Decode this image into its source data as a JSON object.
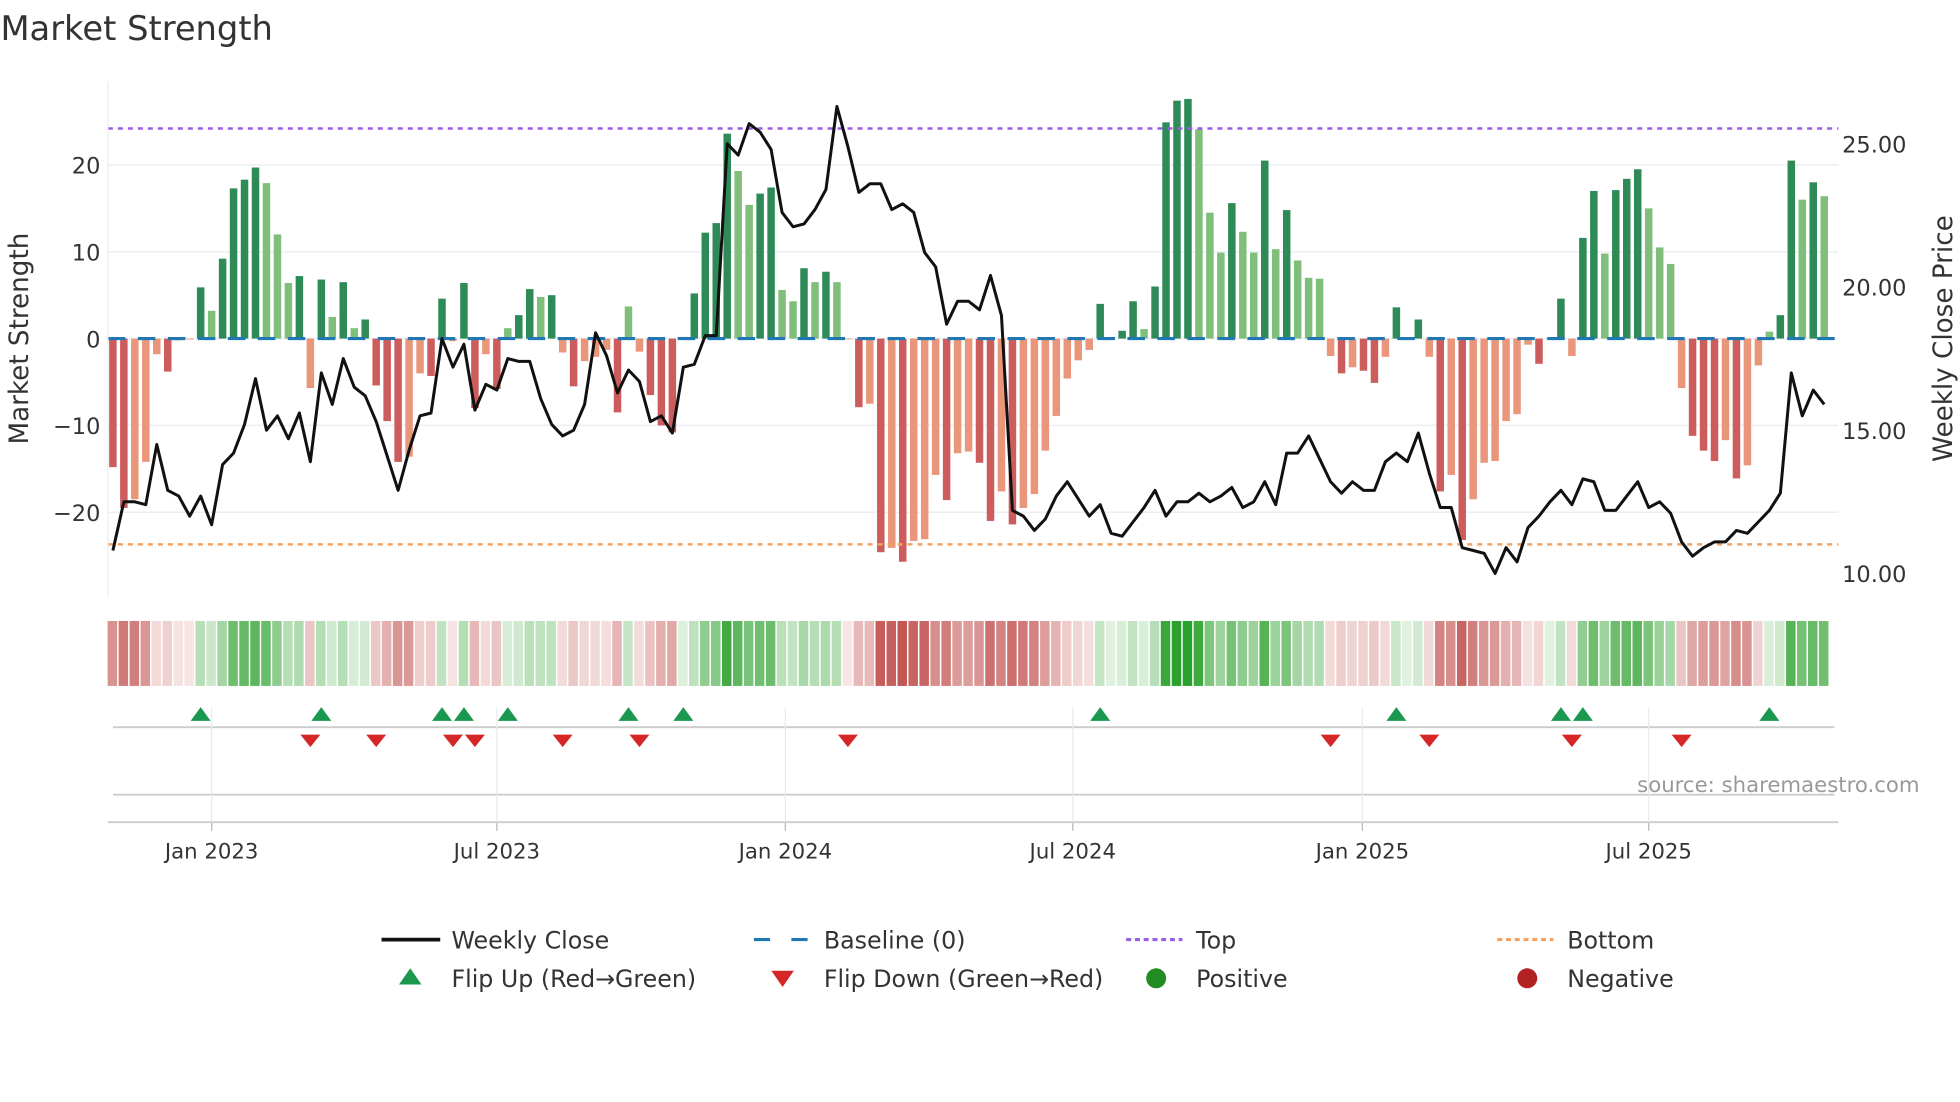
{
  "chart_data": {
    "type": "bar",
    "title": "Market Strength",
    "ylabel": "Market Strength",
    "y2label": "Weekly Close Price",
    "ylim": [
      -29.8,
      29.6
    ],
    "y2lim": [
      9.2,
      27.2
    ],
    "yticks": [
      {
        "v": 20,
        "label": "20"
      },
      {
        "v": 10,
        "label": "10"
      },
      {
        "v": 0,
        "label": "0"
      },
      {
        "v": -10,
        "label": "−10"
      },
      {
        "v": -20,
        "label": "−20"
      }
    ],
    "y2ticks": [
      {
        "v": 25,
        "label": "25.00"
      },
      {
        "v": 20,
        "label": "20.00"
      },
      {
        "v": 15,
        "label": "15.00"
      },
      {
        "v": 10,
        "label": "10.00"
      }
    ],
    "xticks": [
      {
        "week": 9,
        "label": "Jan 2023"
      },
      {
        "week": 35,
        "label": "Jul 2023"
      },
      {
        "week": 61.3,
        "label": "Jan 2024"
      },
      {
        "week": 87.5,
        "label": "Jul 2024"
      },
      {
        "week": 113.9,
        "label": "Jan 2025"
      },
      {
        "week": 140,
        "label": "Jul 2025"
      }
    ],
    "top_level": 24.2,
    "bottom_level": -23.7,
    "baseline": 0,
    "strength": [
      -14.8,
      -19.5,
      -18.5,
      -14.2,
      -1.8,
      -3.8,
      -0.2,
      -0.1,
      5.9,
      3.2,
      9.2,
      17.3,
      18.3,
      19.7,
      17.9,
      12,
      6.4,
      7.2,
      -5.7,
      6.8,
      2.5,
      6.5,
      1.2,
      2.2,
      -5.4,
      -9.5,
      -14.2,
      -13.6,
      -4,
      -4.3,
      4.6,
      -0.3,
      6.4,
      -8,
      -1.8,
      -5.8,
      1.2,
      2.7,
      5.7,
      4.8,
      5.0,
      -1.6,
      -5.5,
      -2.6,
      -2.1,
      -1.3,
      -8.5,
      3.7,
      -1.5,
      -6.5,
      -10,
      -10.8,
      0.2,
      5.2,
      12.2,
      13.3,
      23.6,
      19.3,
      15.4,
      16.7,
      17.4,
      5.6,
      4.3,
      8.1,
      6.5,
      7.7,
      6.5,
      -0.1,
      -7.9,
      -7.5,
      -24.6,
      -24.1,
      -25.7,
      -23.3,
      -23.1,
      -15.7,
      -18.6,
      -13.2,
      -13,
      -14.3,
      -21,
      -17.6,
      -21.4,
      -19.5,
      -17.9,
      -12.9,
      -8.9,
      -4.6,
      -2.5,
      -1.3,
      4.0,
      0,
      0.9,
      4.3,
      1.1,
      6,
      24.9,
      27.4,
      27.6,
      24.1,
      14.5,
      9.9,
      15.6,
      12.3,
      9.9,
      20.5,
      10.3,
      14.8,
      9,
      7.0,
      6.9,
      -2,
      -4,
      -3.3,
      -3.7,
      -5.1,
      -2.1,
      3.6,
      0,
      2.2,
      -2.1,
      -17.6,
      -15.7,
      -23.2,
      -18.5,
      -14.3,
      -14.1,
      -9.5,
      -8.7,
      -0.7,
      -2.9,
      0,
      4.6,
      -2,
      11.6,
      17,
      9.8,
      17.1,
      18.4,
      19.5,
      15,
      10.5,
      8.6,
      -5.7,
      -11.2,
      -12.9,
      -14.1,
      -11.7,
      -16.1,
      -14.6,
      -3.1,
      0.8,
      2.7,
      20.5,
      16,
      18,
      16.4
    ],
    "weekly_close": [
      10.8,
      12.5,
      12.5,
      12.4,
      14.5,
      12.9,
      12.7,
      12.0,
      12.7,
      11.7,
      13.8,
      14.2,
      15.2,
      16.8,
      15.0,
      15.5,
      14.7,
      15.6,
      13.9,
      17.0,
      15.9,
      17.5,
      16.5,
      16.2,
      15.3,
      14.1,
      12.9,
      14.3,
      15.5,
      15.6,
      18.2,
      17.2,
      18.0,
      15.7,
      16.6,
      16.4,
      17.5,
      17.4,
      17.4,
      16.1,
      15.2,
      14.8,
      15.0,
      15.9,
      18.4,
      17.6,
      16.3,
      17.1,
      16.7,
      15.3,
      15.5,
      14.9,
      17.2,
      17.3,
      18.3,
      18.3,
      25.0,
      24.6,
      25.7,
      25.4,
      24.8,
      22.6,
      22.1,
      22.2,
      22.7,
      23.4,
      26.3,
      24.9,
      23.3,
      23.6,
      23.6,
      22.7,
      22.9,
      22.6,
      21.2,
      20.7,
      18.7,
      19.5,
      19.5,
      19.2,
      20.4,
      19.0,
      12.2,
      12.0,
      11.5,
      11.9,
      12.7,
      13.2,
      12.6,
      12.0,
      12.4,
      11.4,
      11.3,
      11.8,
      12.3,
      12.9,
      12.0,
      12.5,
      12.5,
      12.8,
      12.5,
      12.7,
      13.0,
      12.3,
      12.5,
      13.2,
      12.4,
      14.2,
      14.2,
      14.8,
      14.0,
      13.2,
      12.8,
      13.2,
      12.9,
      12.9,
      13.9,
      14.2,
      13.9,
      14.9,
      13.5,
      12.3,
      12.3,
      10.9,
      10.8,
      10.7,
      10.0,
      10.9,
      10.4,
      11.6,
      12.0,
      12.5,
      12.9,
      12.4,
      13.3,
      13.2,
      12.2,
      12.2,
      12.7,
      13.2,
      12.3,
      12.5,
      12.1,
      11.1,
      10.6,
      10.9,
      11.1,
      11.1,
      11.5,
      11.4,
      11.8,
      12.2,
      12.8,
      17.0,
      15.5,
      16.4,
      15.9
    ],
    "legend": {
      "placement": "bottom",
      "items": [
        {
          "key": "close",
          "label": "Weekly Close"
        },
        {
          "key": "baseline",
          "label": "Baseline (0)"
        },
        {
          "key": "top",
          "label": "Top"
        },
        {
          "key": "bottom",
          "label": "Bottom"
        },
        {
          "key": "flipup",
          "label": "Flip Up (Red→Green)"
        },
        {
          "key": "flipdown",
          "label": "Flip Down (Green→Red)"
        },
        {
          "key": "positive",
          "label": "Positive"
        },
        {
          "key": "negative",
          "label": "Negative"
        }
      ]
    },
    "source": "source: sharemaestro.com",
    "colors": {
      "pos_dark": "#2e8b57",
      "pos_light": "#7fbf7b",
      "neg_dark": "#cd5c5c",
      "neg_light": "#e9967a",
      "close": "#111111",
      "baseline": "#1f77b4",
      "top": "#9b5de5",
      "bottom": "#f4a261",
      "flipup": "#1a9850",
      "flipdown": "#d62728",
      "positive": "#228b22",
      "negative": "#b22222"
    }
  }
}
